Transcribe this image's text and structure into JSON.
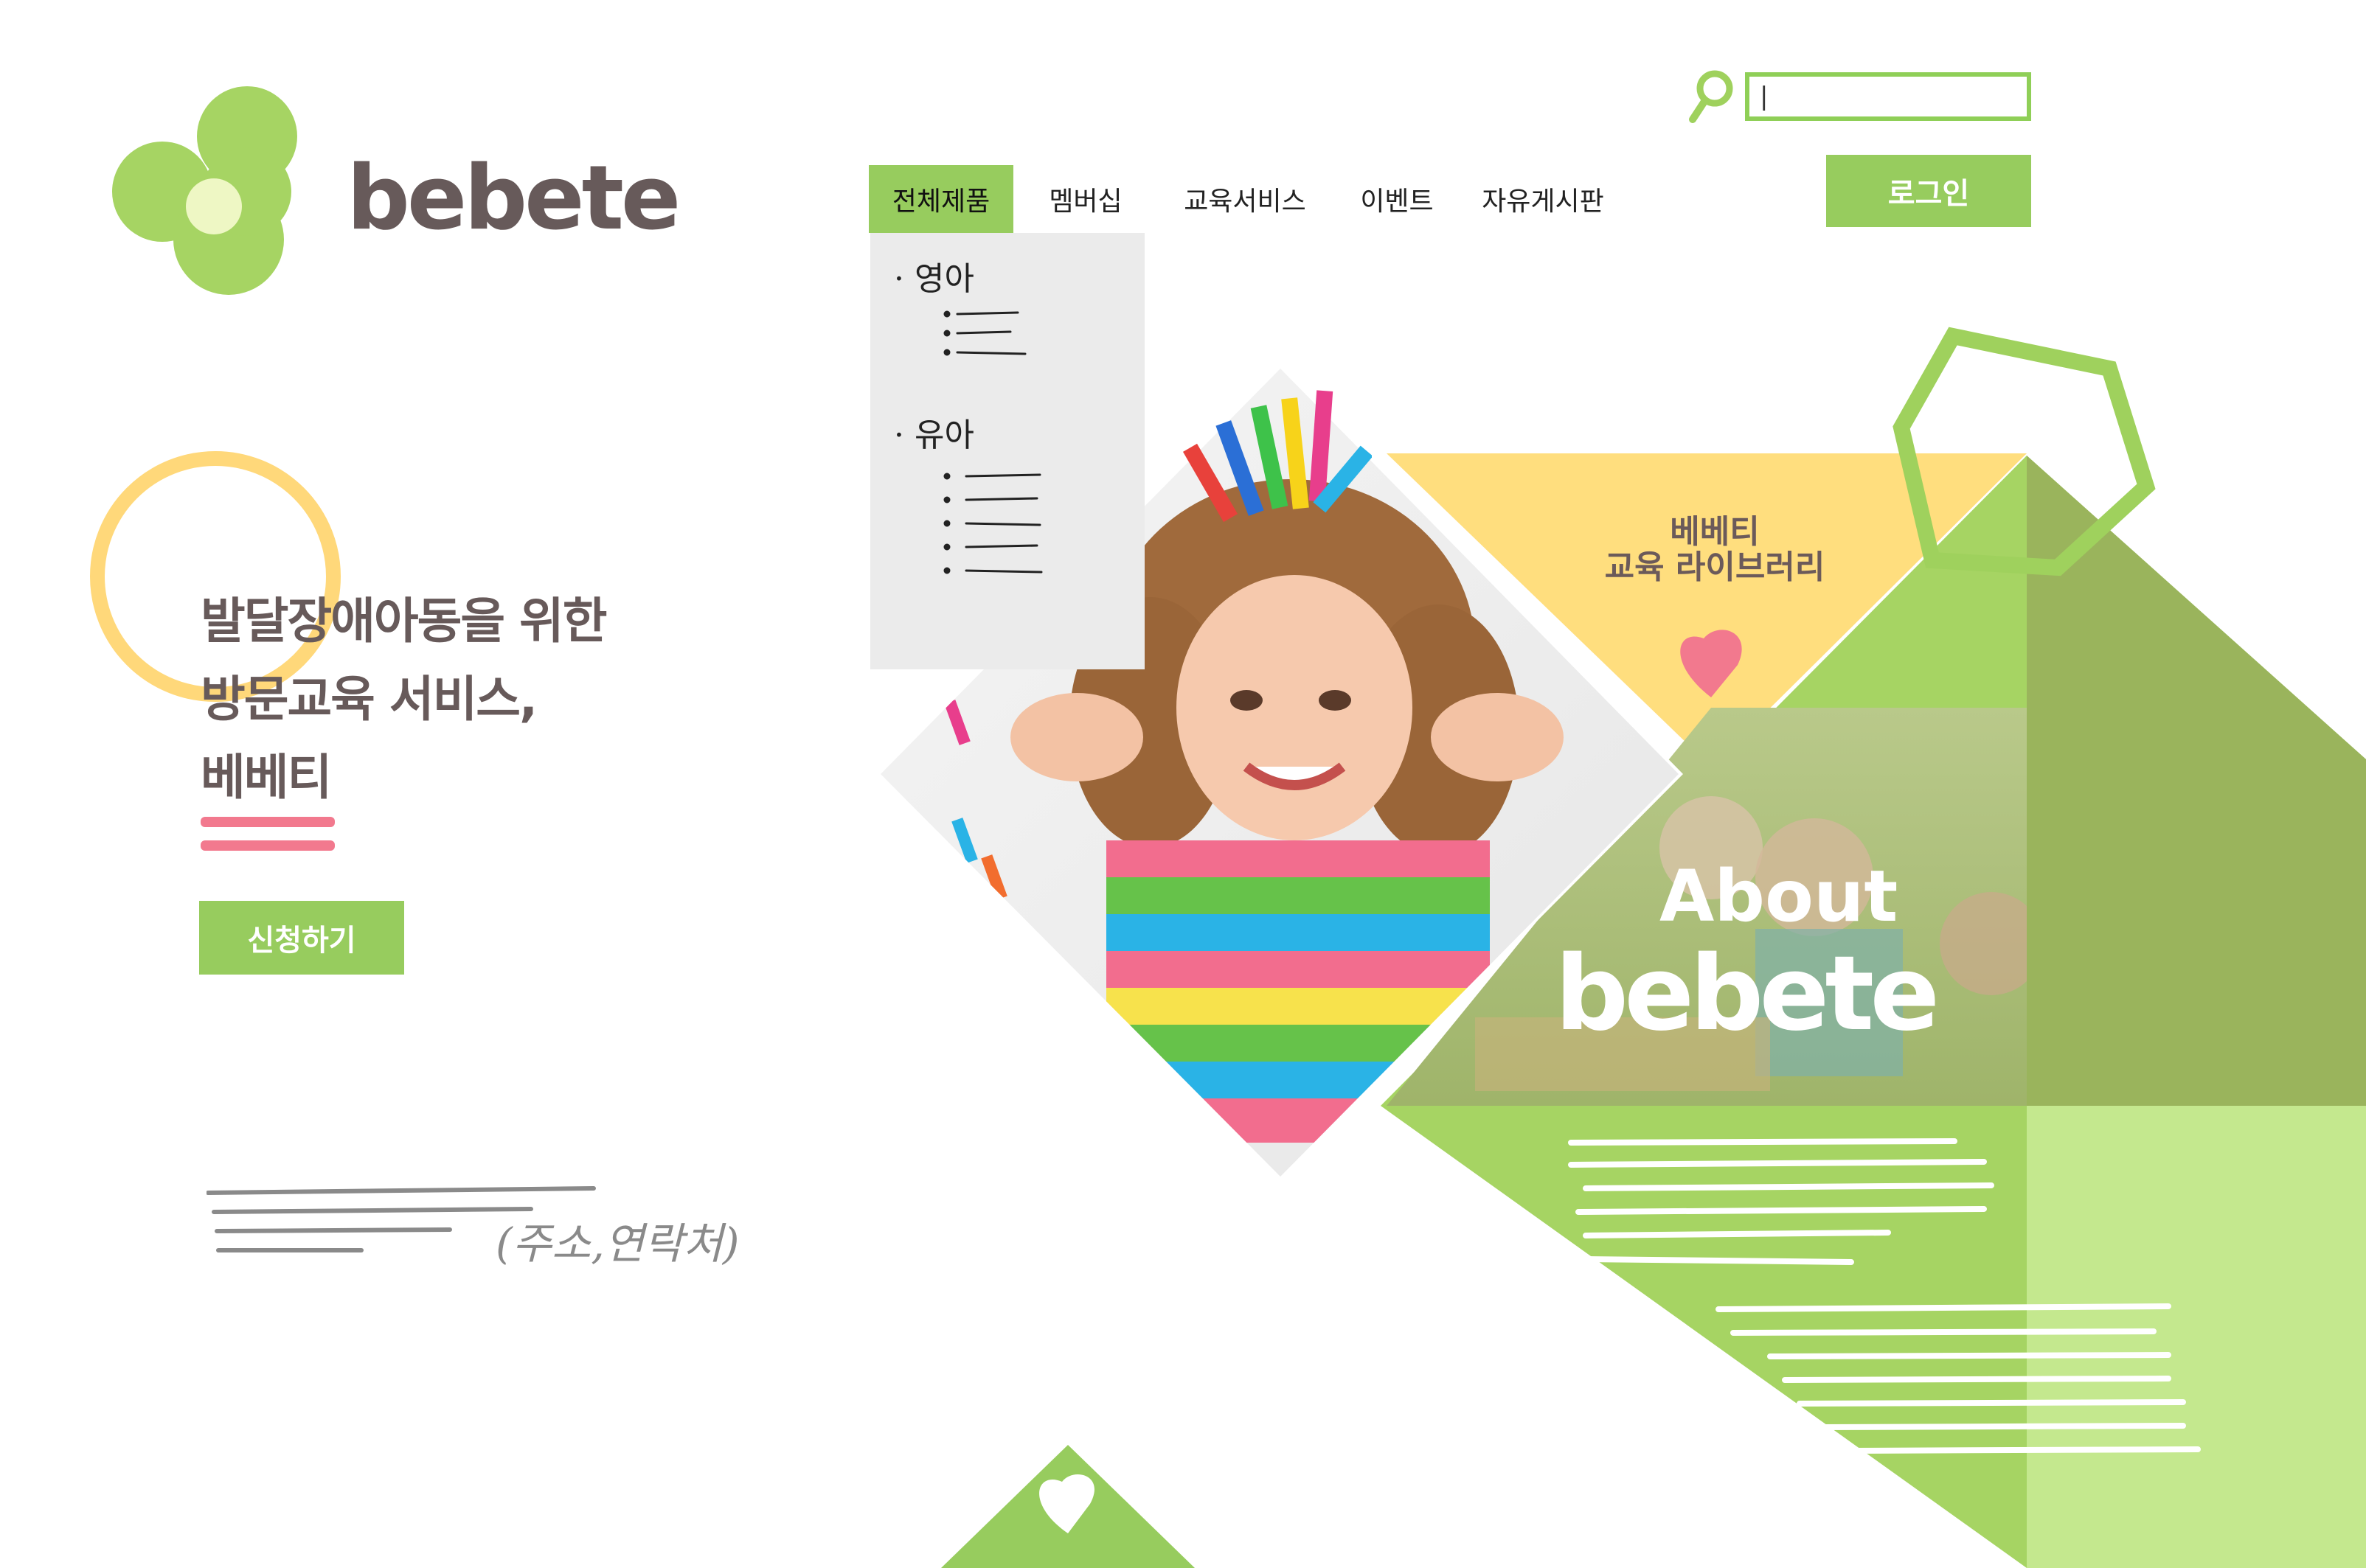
{
  "brand": {
    "logo_word": "bebete"
  },
  "search": {
    "value": "|",
    "placeholder": ""
  },
  "header": {
    "login_label": "로그인"
  },
  "nav": {
    "items": [
      {
        "label": "전체제품",
        "active": true
      },
      {
        "label": "멤버십",
        "active": false
      },
      {
        "label": "교육서비스",
        "active": false
      },
      {
        "label": "이벤트",
        "active": false
      },
      {
        "label": "자유게시판",
        "active": false
      }
    ],
    "dropdown": {
      "groups": [
        "영아",
        "유아"
      ]
    }
  },
  "hero": {
    "lines": [
      "발달장애아동을 위한",
      "방문교육 서비스,",
      "베베티"
    ],
    "apply_label": "신청하기"
  },
  "footer": {
    "note": "(주소,연락처)"
  },
  "library": {
    "line1": "베베티",
    "line2": "교육 라이브러리"
  },
  "about": {
    "title": "About",
    "brand": "bebete"
  },
  "colors": {
    "green": "#97cc5e",
    "light_green": "#bfe48c",
    "olive_green": "#8fb158",
    "yellow": "#ffde7e",
    "pink": "#f2798e",
    "brown": "#675a5a"
  }
}
